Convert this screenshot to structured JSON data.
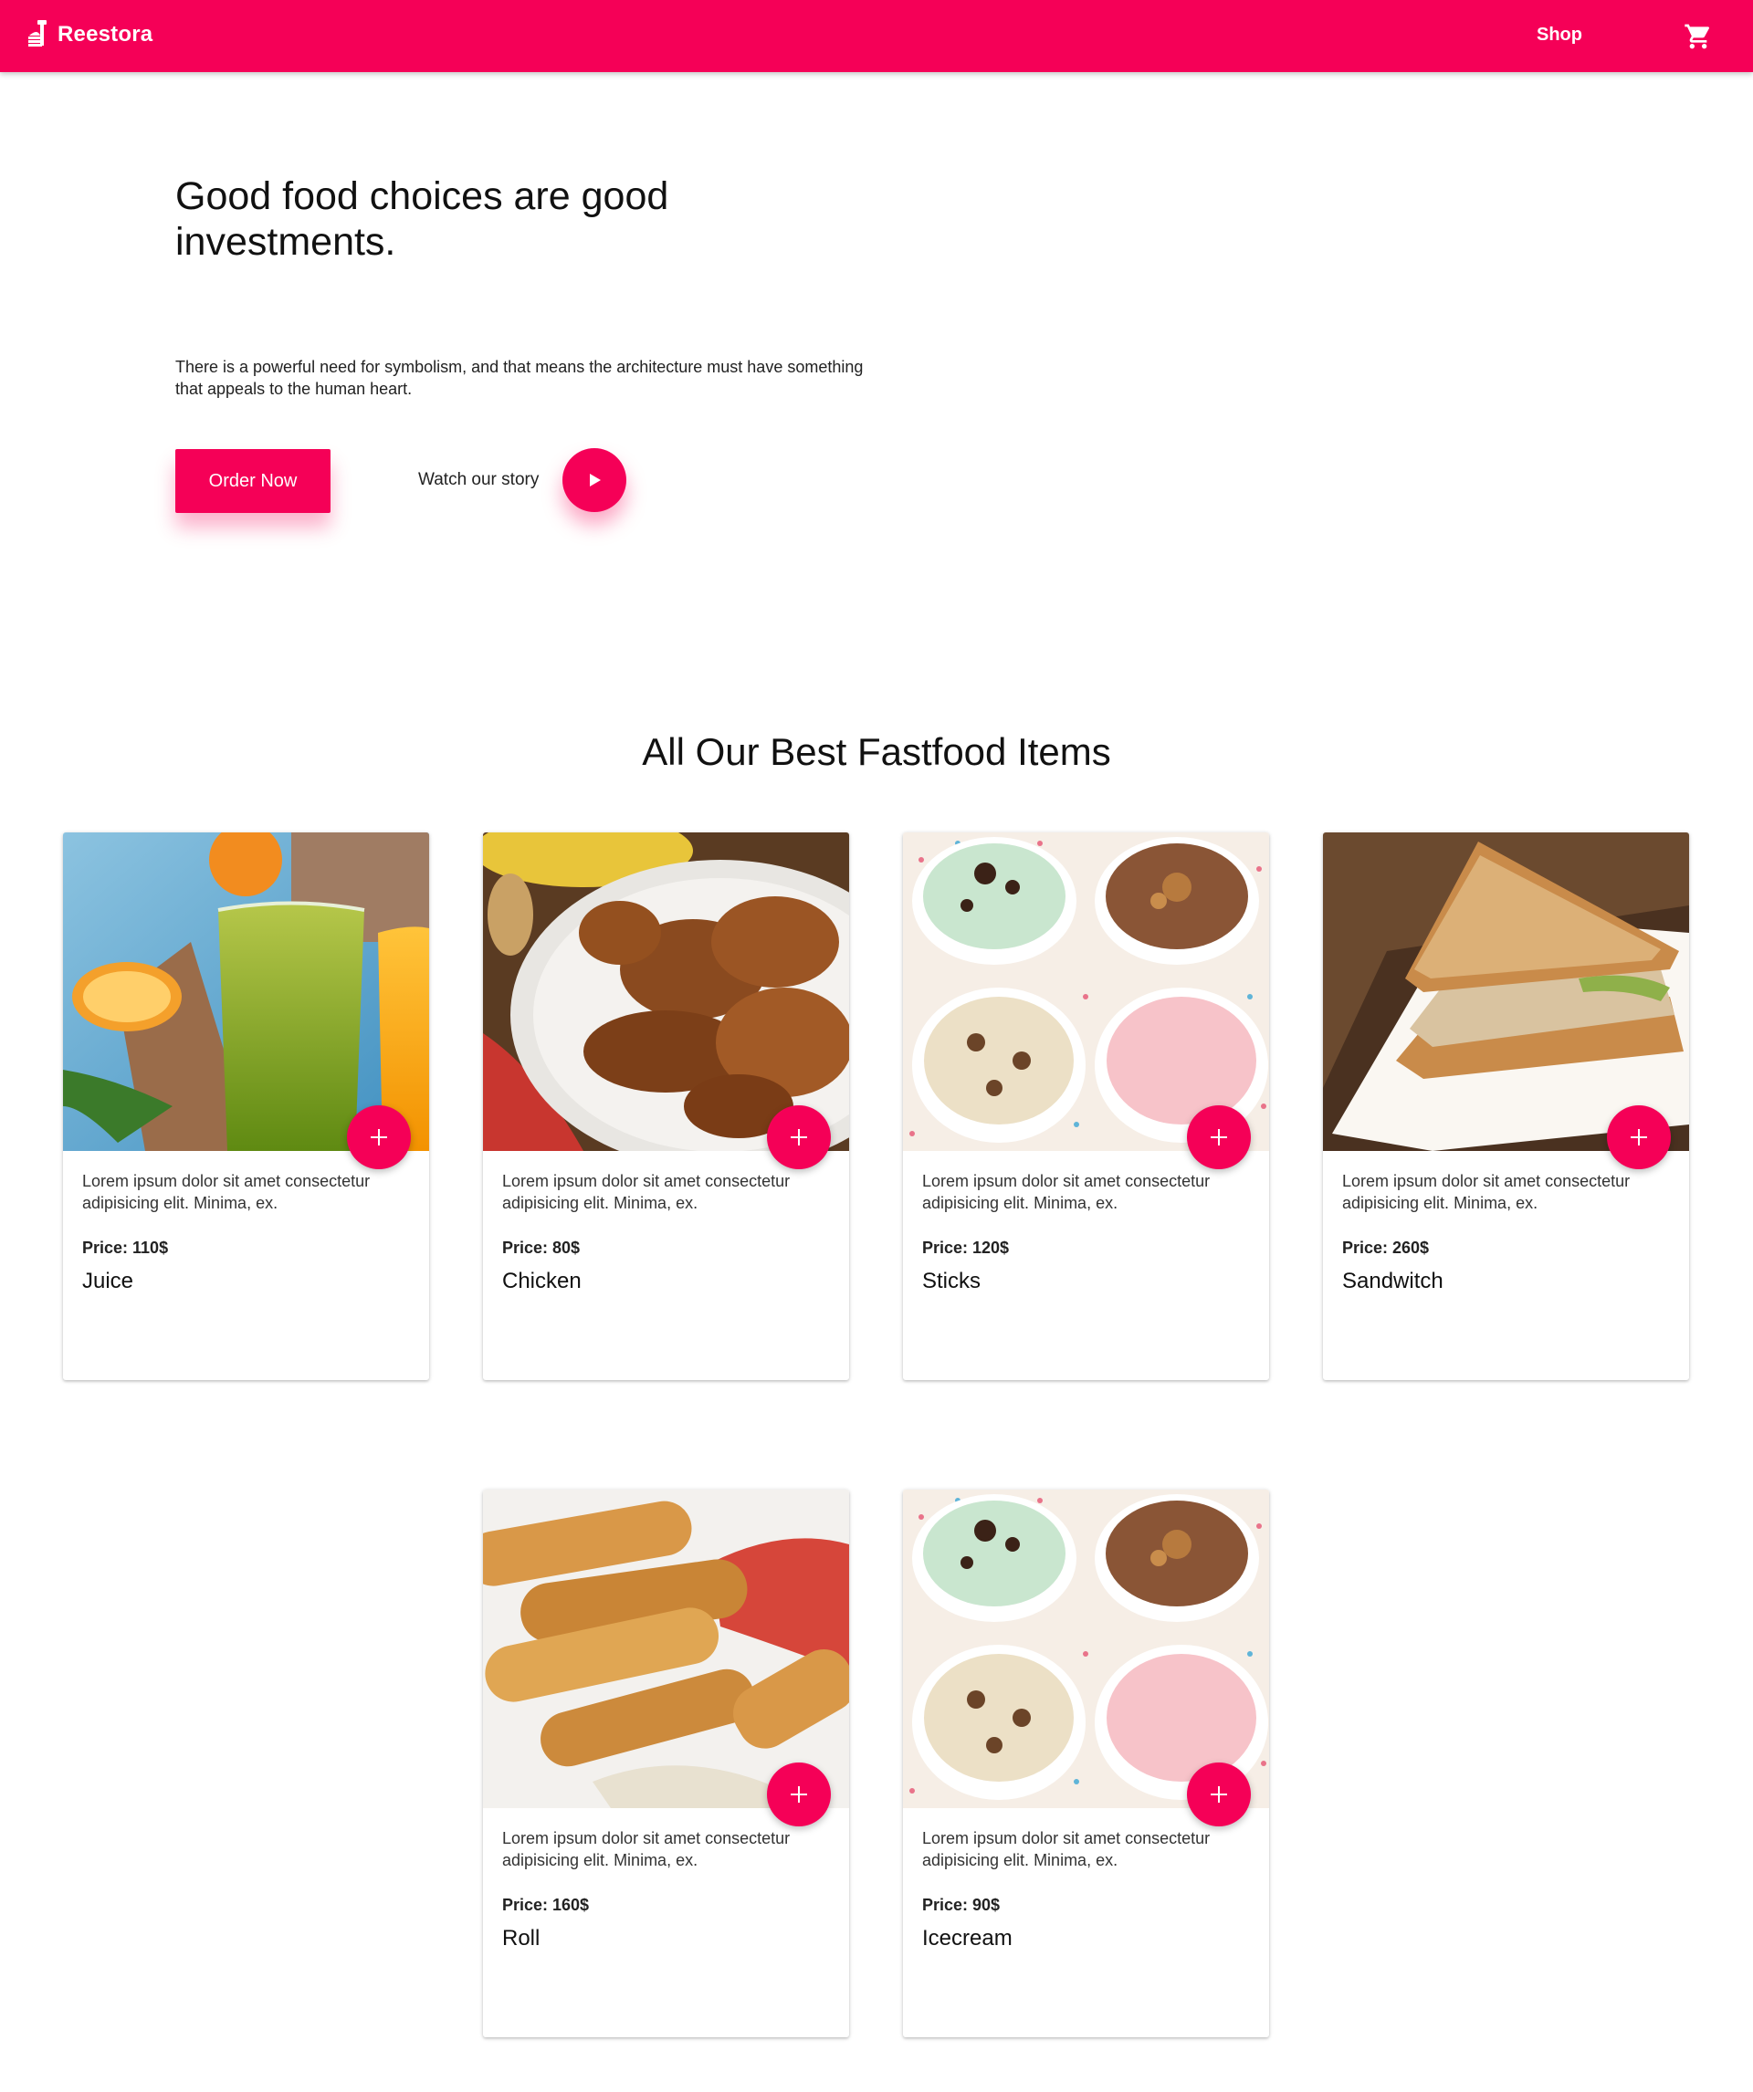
{
  "navbar": {
    "brand": "Reestora",
    "shop_label": "Shop",
    "accent_color": "#f50057"
  },
  "hero": {
    "title": "Good food choices are good investments.",
    "text": "There is a powerful need for symbolism, and that means the architecture must have something that appeals to the human heart.",
    "order_label": "Order Now",
    "watch_label": "Watch our story"
  },
  "products_title": "All Our Best Fastfood Items",
  "products": [
    {
      "image": "juice",
      "description": "Lorem ipsum dolor sit amet consectetur adipisicing elit. Minima, ex.",
      "price": "Price: 110$",
      "name": "Juice"
    },
    {
      "image": "chicken",
      "description": "Lorem ipsum dolor sit amet consectetur adipisicing elit. Minima, ex.",
      "price": "Price: 80$",
      "name": "Chicken"
    },
    {
      "image": "icecream",
      "description": "Lorem ipsum dolor sit amet consectetur adipisicing elit. Minima, ex.",
      "price": "Price: 120$",
      "name": "Sticks"
    },
    {
      "image": "sandwich",
      "description": "Lorem ipsum dolor sit amet consectetur adipisicing elit. Minima, ex.",
      "price": "Price: 260$",
      "name": "Sandwitch"
    },
    {
      "image": "rolls",
      "description": "Lorem ipsum dolor sit amet consectetur adipisicing elit. Minima, ex.",
      "price": "Price: 160$",
      "name": "Roll"
    },
    {
      "image": "icecream",
      "description": "Lorem ipsum dolor sit amet consectetur adipisicing elit. Minima, ex.",
      "price": "Price: 90$",
      "name": "Icecream"
    }
  ]
}
